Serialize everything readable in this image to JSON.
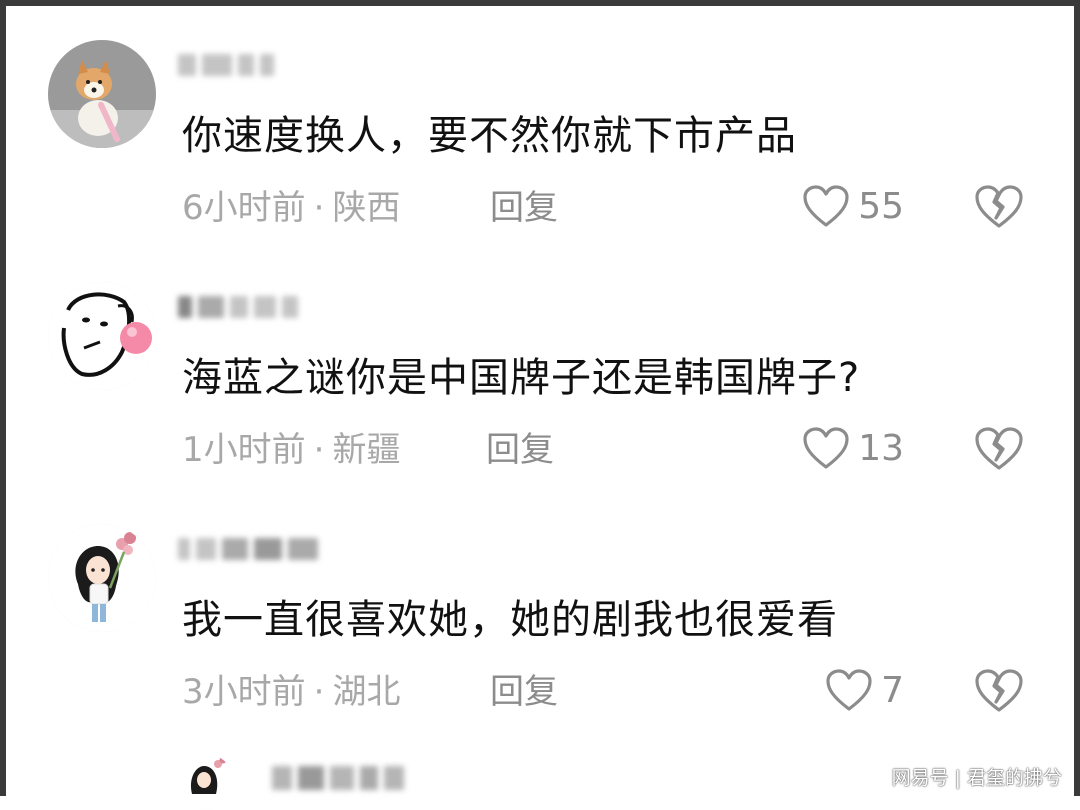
{
  "comments": [
    {
      "text": "你速度换人，要不然你就下市产品",
      "time": "6小时前",
      "location": "陕西",
      "reply": "回复",
      "likes": "55"
    },
    {
      "text": "海蓝之谜你是中国牌子还是韩国牌子?",
      "time": "1小时前",
      "location": "新疆",
      "reply": "回复",
      "likes": "13"
    },
    {
      "text": "我一直很喜欢她，她的剧我也很爱看",
      "time": "3小时前",
      "location": "湖北",
      "reply": "回复",
      "likes": "7"
    }
  ],
  "meta_separator": "·",
  "watermark": {
    "platform": "网易号",
    "separator": "|",
    "author": "君玺的拂兮"
  },
  "colors": {
    "text": "#111111",
    "meta": "#a8a8a8",
    "icon": "#8c8c8c",
    "frame": "#3a3a3a"
  },
  "icons": {
    "like": "heart-outline-icon",
    "dislike": "broken-heart-icon"
  }
}
